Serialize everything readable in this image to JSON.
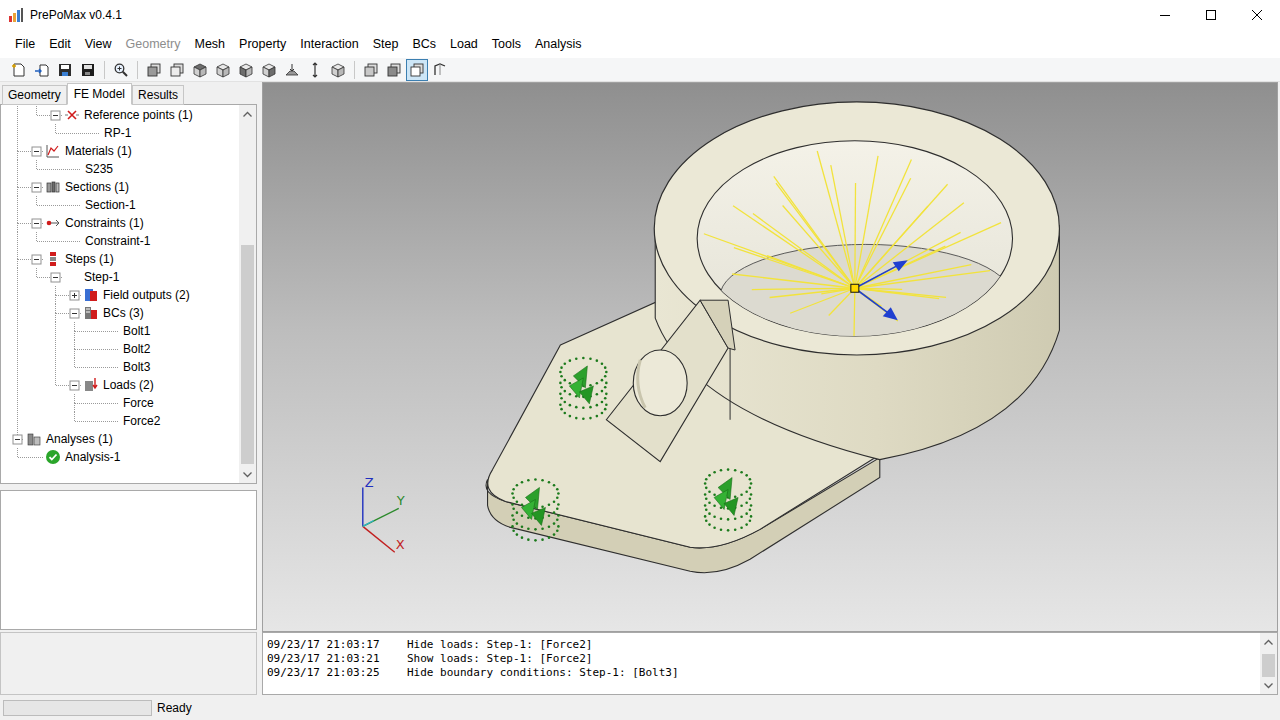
{
  "window": {
    "title": "PrePoMax v0.4.1"
  },
  "menu": [
    {
      "label": "File",
      "disabled": false
    },
    {
      "label": "Edit",
      "disabled": false
    },
    {
      "label": "View",
      "disabled": false
    },
    {
      "label": "Geometry",
      "disabled": true
    },
    {
      "label": "Mesh",
      "disabled": false
    },
    {
      "label": "Property",
      "disabled": false
    },
    {
      "label": "Interaction",
      "disabled": false
    },
    {
      "label": "Step",
      "disabled": false
    },
    {
      "label": "BCs",
      "disabled": false
    },
    {
      "label": "Load",
      "disabled": false
    },
    {
      "label": "Tools",
      "disabled": false
    },
    {
      "label": "Analysis",
      "disabled": false
    }
  ],
  "toolbar": [
    {
      "selected": false
    },
    {
      "selected": false
    },
    {
      "selected": false
    },
    {
      "selected": false
    },
    {
      "selected": false
    },
    {
      "selected": false
    },
    {
      "selected": false
    },
    {
      "selected": false
    },
    {
      "selected": false
    },
    {
      "selected": false
    },
    {
      "selected": false
    },
    {
      "selected": false
    },
    {
      "selected": false
    },
    {
      "selected": false
    },
    {
      "selected": false
    },
    {
      "selected": false
    },
    {
      "selected": true
    },
    {
      "selected": false
    }
  ],
  "panel_tabs": [
    {
      "label": "Geometry",
      "selected": false
    },
    {
      "label": "FE Model",
      "selected": true
    },
    {
      "label": "Results",
      "selected": false
    }
  ],
  "tree": [
    {
      "label": "Reference points (1)",
      "depth": 2,
      "kind": "group",
      "expanded": true
    },
    {
      "label": "RP-1",
      "depth": 3,
      "kind": "leaf"
    },
    {
      "label": "Materials (1)",
      "depth": 1,
      "kind": "group",
      "expanded": true
    },
    {
      "label": "S235",
      "depth": 2,
      "kind": "leaf"
    },
    {
      "label": "Sections (1)",
      "depth": 1,
      "kind": "group",
      "expanded": true
    },
    {
      "label": "Section-1",
      "depth": 2,
      "kind": "leaf"
    },
    {
      "label": "Constraints (1)",
      "depth": 1,
      "kind": "group",
      "expanded": true
    },
    {
      "label": "Constraint-1",
      "depth": 2,
      "kind": "leaf"
    },
    {
      "label": "Steps (1)",
      "depth": 1,
      "kind": "group",
      "expanded": true
    },
    {
      "label": "Step-1",
      "depth": 2,
      "kind": "group",
      "expanded": true
    },
    {
      "label": "Field outputs (2)",
      "depth": 3,
      "kind": "group",
      "expanded": false
    },
    {
      "label": "BCs (3)",
      "depth": 3,
      "kind": "group",
      "expanded": true
    },
    {
      "label": "Bolt1",
      "depth": 4,
      "kind": "leaf"
    },
    {
      "label": "Bolt2",
      "depth": 4,
      "kind": "leaf"
    },
    {
      "label": "Bolt3",
      "depth": 4,
      "kind": "leaf"
    },
    {
      "label": "Loads (2)",
      "depth": 3,
      "kind": "group",
      "expanded": true
    },
    {
      "label": "Force",
      "depth": 4,
      "kind": "leaf"
    },
    {
      "label": "Force2",
      "depth": 4,
      "kind": "leaf"
    },
    {
      "label": "Analyses (1)",
      "depth": 0,
      "kind": "group",
      "expanded": true
    },
    {
      "label": "Analysis-1",
      "depth": 1,
      "kind": "leaf",
      "completed": true
    }
  ],
  "viewport": {
    "axes": [
      {
        "label": "Z",
        "color": "#1f2fbf"
      },
      {
        "label": "Y",
        "color": "#2b8a2b"
      },
      {
        "label": "X",
        "color": "#c21f1f"
      }
    ]
  },
  "log": [
    {
      "time": "09/23/17 21:03:17",
      "message": "Hide loads: Step-1: [Force2]"
    },
    {
      "time": "09/23/17 21:03:21",
      "message": "Show loads: Step-1: [Force2]"
    },
    {
      "time": "09/23/17 21:03:25",
      "message": "Hide boundary conditions: Step-1: [Bolt3]"
    }
  ],
  "status_bar": {
    "progress": {
      "level": 0
    },
    "text": "Ready"
  }
}
